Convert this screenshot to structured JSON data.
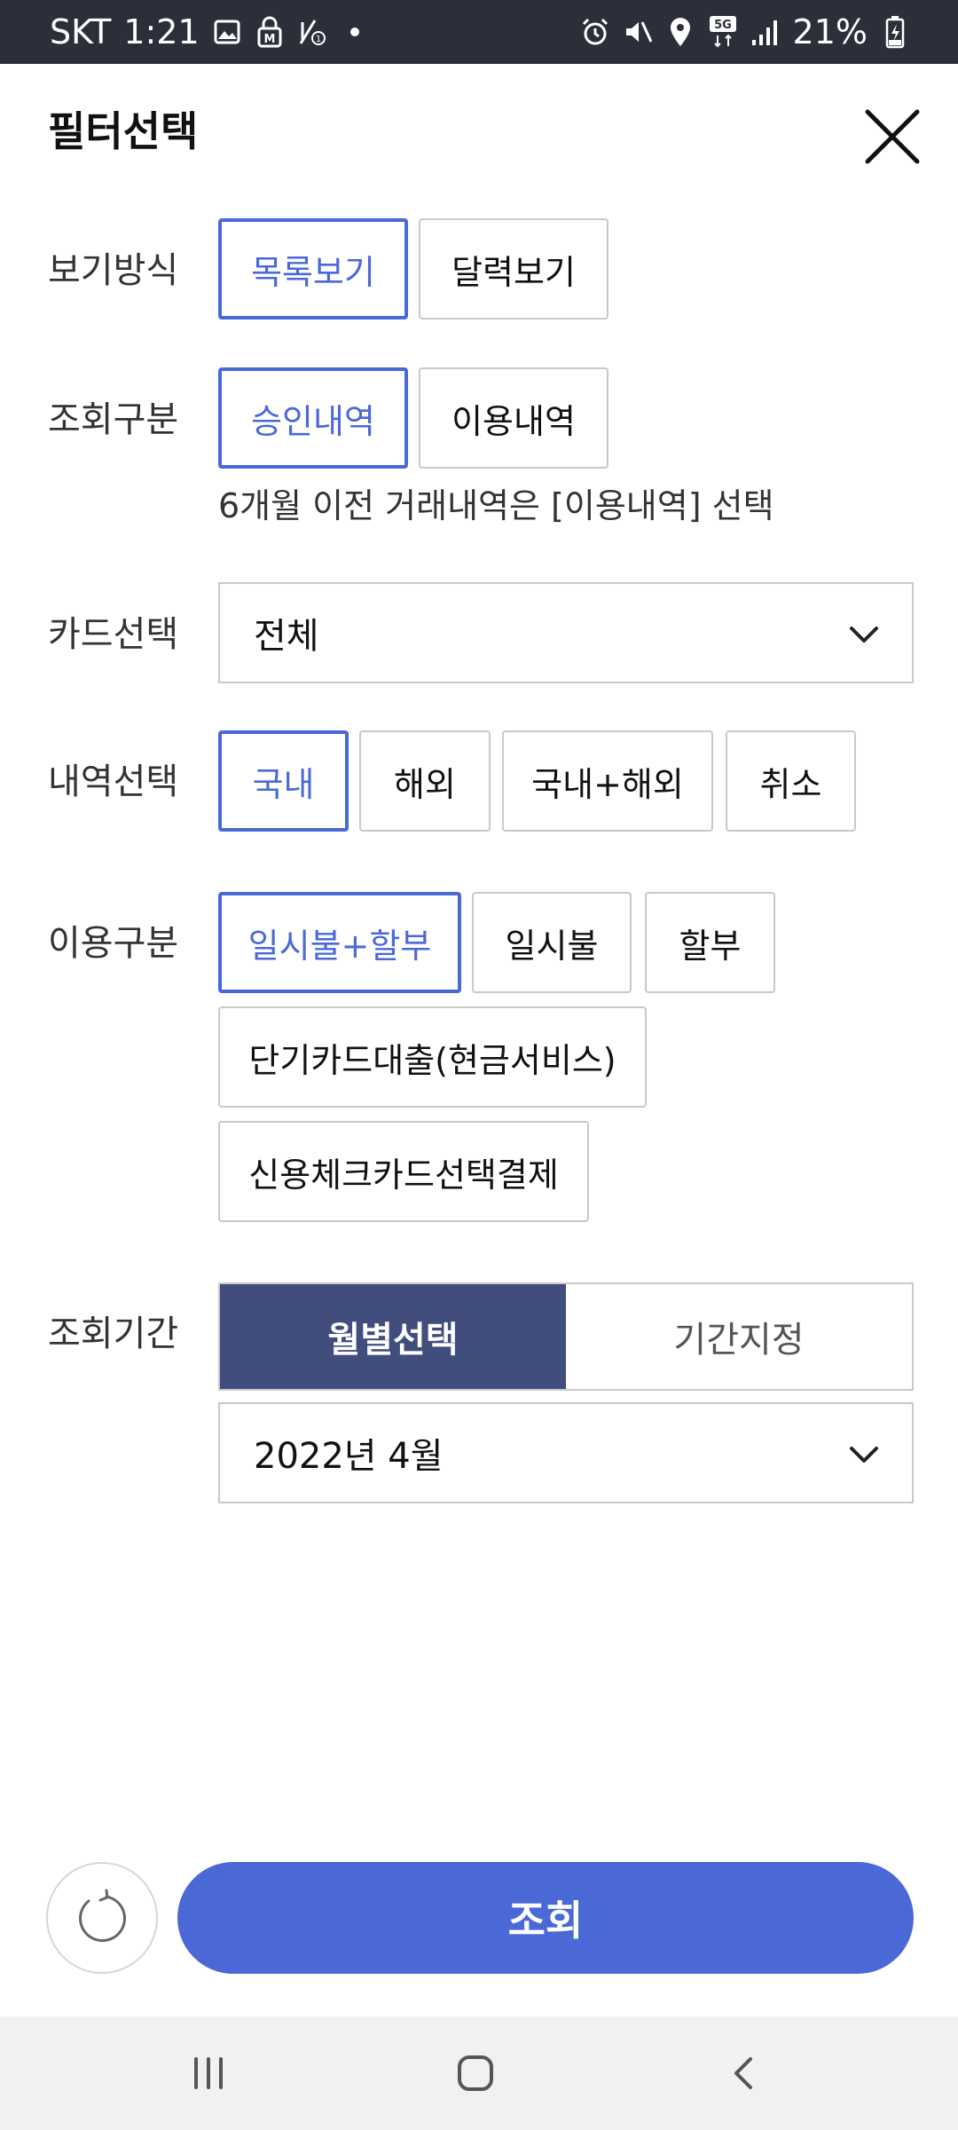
{
  "status_bar": {
    "carrier": "SKT",
    "time": "1:21",
    "battery": "21%",
    "icons": [
      "gallery-icon",
      "lock-icon",
      "call-icon",
      "dot-icon",
      "alarm-icon",
      "mute-icon",
      "location-icon",
      "5g-icon",
      "signal-icon",
      "battery-icon"
    ]
  },
  "header": {
    "title": "필터선택",
    "close_icon": "close-icon"
  },
  "view_mode": {
    "label": "보기방식",
    "options": [
      "목록보기",
      "달력보기"
    ],
    "selected": "목록보기"
  },
  "inquiry_type": {
    "label": "조회구분",
    "options": [
      "승인내역",
      "이용내역"
    ],
    "selected": "승인내역",
    "note": "6개월 이전 거래내역은 [이용내역] 선택"
  },
  "card_select": {
    "label": "카드선택",
    "value": "전체"
  },
  "history_select": {
    "label": "내역선택",
    "options": [
      "국내",
      "해외",
      "국내+해외",
      "취소"
    ],
    "selected": "국내"
  },
  "usage_type": {
    "label": "이용구분",
    "options": [
      "일시불+할부",
      "일시불",
      "할부",
      "단기카드대출(현금서비스)",
      "신용체크카드선택결제"
    ],
    "selected": "일시불+할부"
  },
  "period": {
    "label": "조회기간",
    "tabs": [
      "월별선택",
      "기간지정"
    ],
    "active": "월별선택",
    "month_value": "2022년 4월"
  },
  "actions": {
    "submit_label": "조회",
    "reset_icon": "reset-icon"
  },
  "colors": {
    "accent": "#4a69d6",
    "segment_active": "#404d7d",
    "status_bar": "#2b2f3a"
  }
}
